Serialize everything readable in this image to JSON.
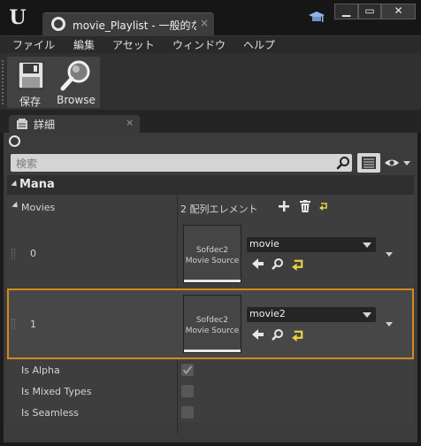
{
  "window": {
    "tab_title": "movie_Playlist - 一般的な",
    "tab_close": "×",
    "min_label": "▁",
    "max_label": "▭",
    "close_label": "✕"
  },
  "menu": {
    "items": [
      "ファイル",
      "編集",
      "アセット",
      "ウィンドウ",
      "ヘルプ"
    ]
  },
  "toolbar": {
    "save_label": "保存",
    "browse_label": "Browse"
  },
  "details": {
    "tab_label": "詳細",
    "tab_close": "×",
    "search_placeholder": "検索"
  },
  "category": {
    "name": "Mana"
  },
  "movies": {
    "label": "Movies",
    "count_text": "2 配列エレメント",
    "elements": [
      {
        "index": "0",
        "asset_name": "movie",
        "thumb_line1": "Sofdec2",
        "thumb_line2": "Movie Source"
      },
      {
        "index": "1",
        "asset_name": "movie2",
        "thumb_line1": "Sofdec2",
        "thumb_line2": "Movie Source"
      }
    ]
  },
  "properties": [
    {
      "label": "Is Alpha",
      "checked": true
    },
    {
      "label": "Is Mixed Types",
      "checked": false
    },
    {
      "label": "Is Seamless",
      "checked": false
    }
  ],
  "colors": {
    "selection_border": "#d38a1c",
    "accent_yellow": "#e8d040"
  }
}
